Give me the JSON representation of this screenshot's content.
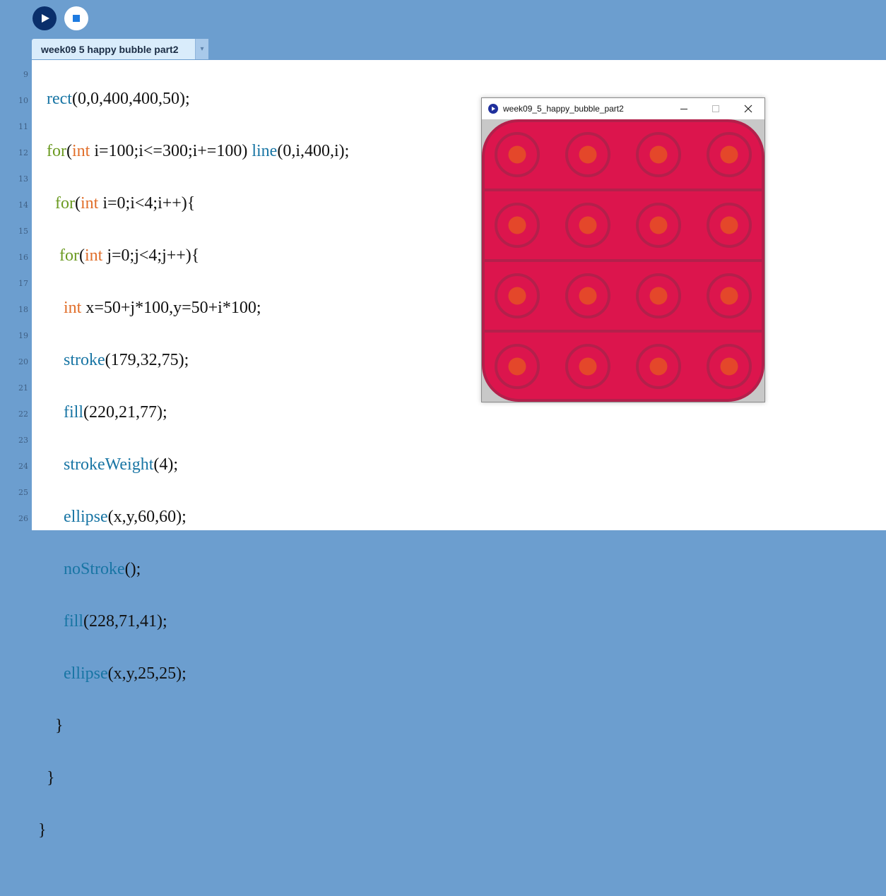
{
  "toolbar": {
    "run_icon": "play-icon",
    "stop_icon": "stop-icon"
  },
  "tab": {
    "label": "week09 5 happy bubble part2",
    "menu_glyph": "▾"
  },
  "editor": {
    "line_numbers": [
      "9",
      "10",
      "11",
      "12",
      "13",
      "14",
      "15",
      "16",
      "17",
      "18",
      "19",
      "20",
      "21",
      "22",
      "23",
      "24",
      "25",
      "26"
    ]
  },
  "sketch_window": {
    "title": "week09_5_happy_bubble_part2",
    "colors": {
      "background": "#dc154d",
      "stroke": "#b3204b",
      "inner": "#e4472a"
    }
  }
}
